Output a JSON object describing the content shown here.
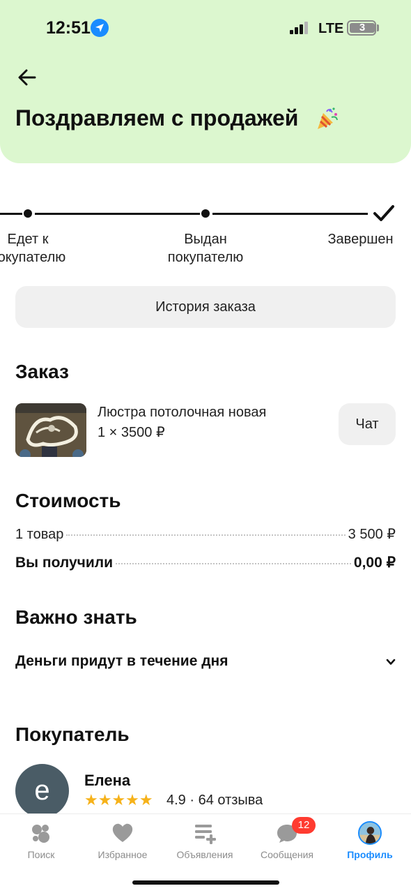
{
  "status_bar": {
    "time": "12:51",
    "network": "LTE",
    "battery": "3"
  },
  "header": {
    "title": "Поздравляем с продажей"
  },
  "tracker": {
    "steps": [
      {
        "label_line1": "Едет к",
        "label_line2": "покупателю"
      },
      {
        "label_line1": "Выдан",
        "label_line2": "покупателю"
      },
      {
        "label_line1": "Завершен",
        "label_line2": ""
      }
    ]
  },
  "history_button": "История заказа",
  "order": {
    "title": "Заказ",
    "product_name": "Люстра потолочная новая",
    "quantity_price": "1 × 3500 ₽",
    "chat_button": "Чат"
  },
  "cost": {
    "title": "Стоимость",
    "rows": [
      {
        "label": "1 товар",
        "value": "3 500 ₽"
      },
      {
        "label": "Вы получили",
        "value": "0,00 ₽"
      }
    ]
  },
  "important": {
    "title": "Важно знать",
    "item": "Деньги придут в течение дня"
  },
  "buyer": {
    "title": "Покупатель",
    "avatar_letter": "e",
    "name": "Елена",
    "stars": "★★★★★",
    "rating": "4.9 · 64 отзыва"
  },
  "tabbar": {
    "tabs": [
      {
        "label": "Поиск",
        "icon": "search-dots-icon"
      },
      {
        "label": "Избранное",
        "icon": "heart-icon"
      },
      {
        "label": "Объявления",
        "icon": "listings-add-icon"
      },
      {
        "label": "Сообщения",
        "icon": "chat-bubble-icon",
        "badge": "12"
      },
      {
        "label": "Профиль",
        "icon": "profile-avatar",
        "active": true
      }
    ]
  },
  "colors": {
    "header_bg": "#dcf7cf",
    "accent": "#1a8cff",
    "badge": "#ff3b30",
    "stars": "#f6b21a"
  }
}
